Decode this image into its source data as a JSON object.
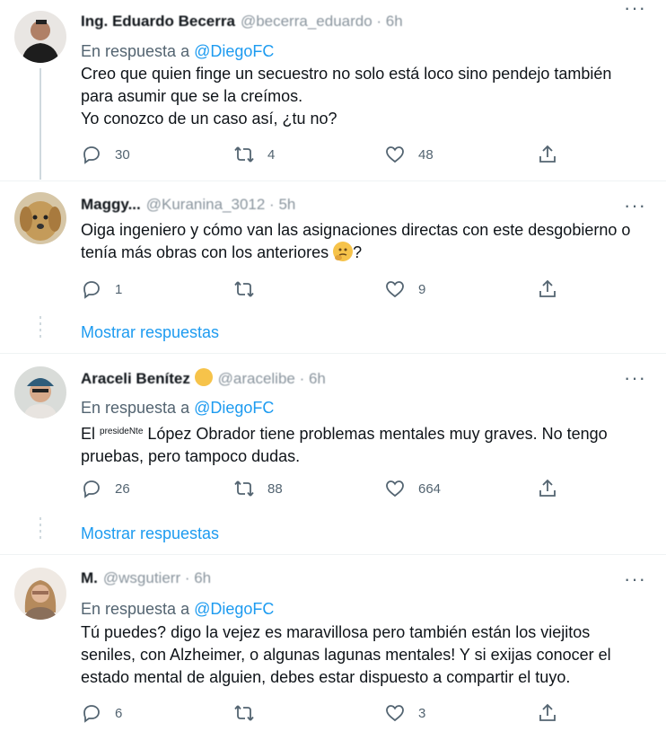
{
  "tweets": [
    {
      "author_name": "Ing. Eduardo Becerra",
      "author_handle": "@becerra_eduardo · 6h",
      "reply_label": "En respuesta a",
      "reply_mention": "@DiegoFC",
      "text": "Creo que quien finge un secuestro no solo está loco sino pendejo también\npara asumir que se la creímos.\nYo conozco de un caso así, ¿tu no?",
      "replies": "30",
      "retweets": "4",
      "likes": "48"
    },
    {
      "author_name": "Maggy...",
      "author_handle": "@Kuranina_3012 · 5h",
      "text_a": "Oiga ingeniero y cómo van las asignaciones directas con este desgobierno o tenía más obras con los anteriores ",
      "text_b": "?",
      "emoji": "thinking-face",
      "replies": "1",
      "retweets": "",
      "likes": "9",
      "show_replies": "Mostrar respuestas"
    },
    {
      "author_name": "Araceli Benítez",
      "author_handle": "@aracelibe · 6h",
      "reply_label": "En respuesta a",
      "reply_mention": "@DiegoFC",
      "text_prefix": "El ",
      "text_sup": "presideNte",
      "text_rest": " López Obrador tiene problemas mentales muy graves. No tengo pruebas, pero tampoco dudas.",
      "replies": "26",
      "retweets": "88",
      "likes": "664",
      "show_replies": "Mostrar respuestas"
    },
    {
      "author_name": "M.",
      "author_handle": "@wsgutierr · 6h",
      "reply_label": "En respuesta a",
      "reply_mention": "@DiegoFC",
      "text": "Tú puedes? digo la vejez es maravillosa pero también están los viejitos\nseniles, con Alzheimer, o algunas lagunas mentales! Y si exijas conocer el\nestado mental de alguien, debes estar dispuesto a compartir el tuyo.",
      "replies": "6",
      "retweets": "",
      "likes": "3"
    }
  ],
  "icons": {
    "reply": "reply-icon",
    "retweet": "retweet-icon",
    "like": "heart-icon",
    "share": "share-icon",
    "more": "more-icon"
  },
  "colors": {
    "link": "#1d9bf0",
    "secondary": "#536471",
    "divider": "#eff3f4"
  }
}
